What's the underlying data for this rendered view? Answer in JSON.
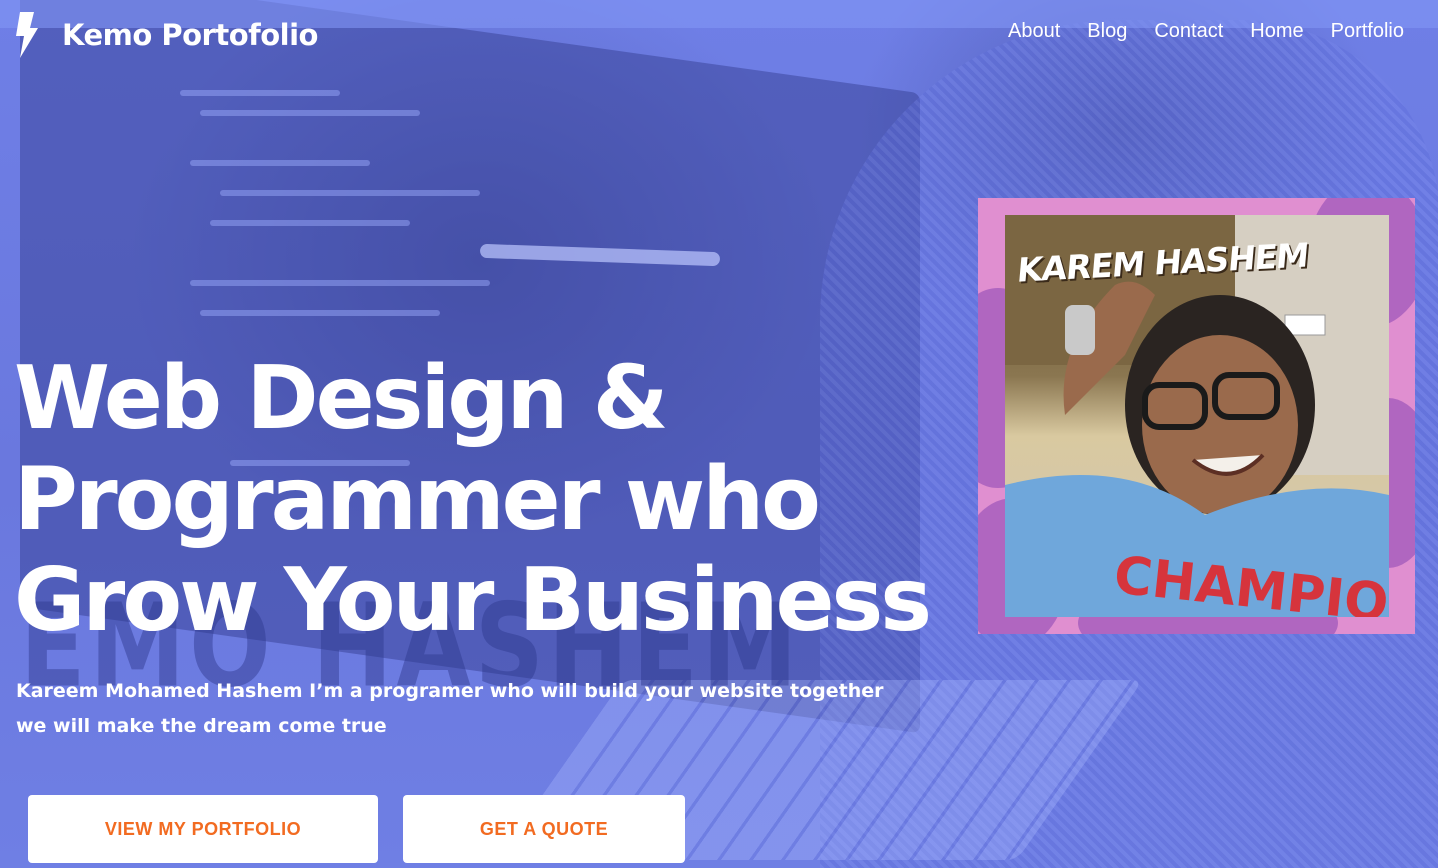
{
  "brand": {
    "name": "Kemo Portofolio",
    "logo_icon": "lightning-bolt-icon"
  },
  "nav": {
    "items": [
      {
        "label": "About"
      },
      {
        "label": "Blog"
      },
      {
        "label": "Contact"
      },
      {
        "label": "Home"
      },
      {
        "label": "Portfolio"
      }
    ]
  },
  "hero": {
    "headline_lines": [
      "Web Design &",
      "Programmer who",
      "Grow Your Business"
    ],
    "tagline_lines": [
      "Kareem Mohamed Hashem I’m a programer who will build your website together",
      "we will make the dream come true"
    ],
    "background_watermark": "EMO HASHEM"
  },
  "buttons": {
    "portfolio_label": "VIEW MY PORTFOLIO",
    "quote_label": "GET A QUOTE"
  },
  "profile": {
    "caption": "KAREM HASHEM",
    "shirt_text": "CHAMPION"
  },
  "colors": {
    "overlay": "#6f7fe6",
    "button_text": "#f26b21",
    "frame": "#e08fd0",
    "frame_blob": "#b066c0"
  }
}
